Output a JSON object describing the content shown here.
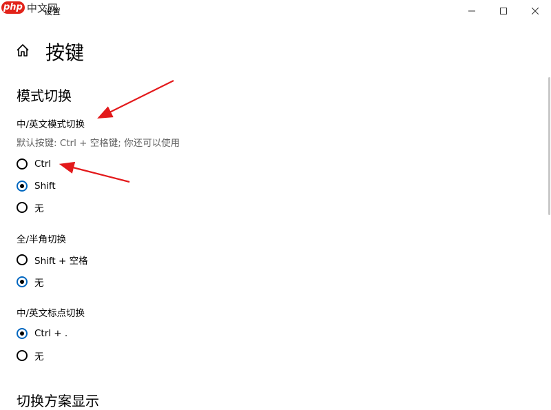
{
  "watermark": {
    "logo": "php",
    "text": "中文网"
  },
  "window": {
    "title": "设置"
  },
  "page": {
    "title": "按键"
  },
  "section": {
    "title": "模式切换"
  },
  "groups": [
    {
      "label": "中/英文模式切换",
      "description": "默认按键: Ctrl + 空格键; 你还可以使用",
      "options": [
        {
          "label": "Ctrl",
          "selected": false
        },
        {
          "label": "Shift",
          "selected": true
        },
        {
          "label": "无",
          "selected": false
        }
      ]
    },
    {
      "label": "全/半角切换",
      "options": [
        {
          "label": "Shift + 空格",
          "selected": false
        },
        {
          "label": "无",
          "selected": true
        }
      ]
    },
    {
      "label": "中/英文标点切换",
      "options": [
        {
          "label": "Ctrl + .",
          "selected": true
        },
        {
          "label": "无",
          "selected": false
        }
      ]
    }
  ],
  "next_section": {
    "title": "切换方案显示"
  },
  "colors": {
    "accent": "#0067c0",
    "annotation": "#e3191b"
  }
}
